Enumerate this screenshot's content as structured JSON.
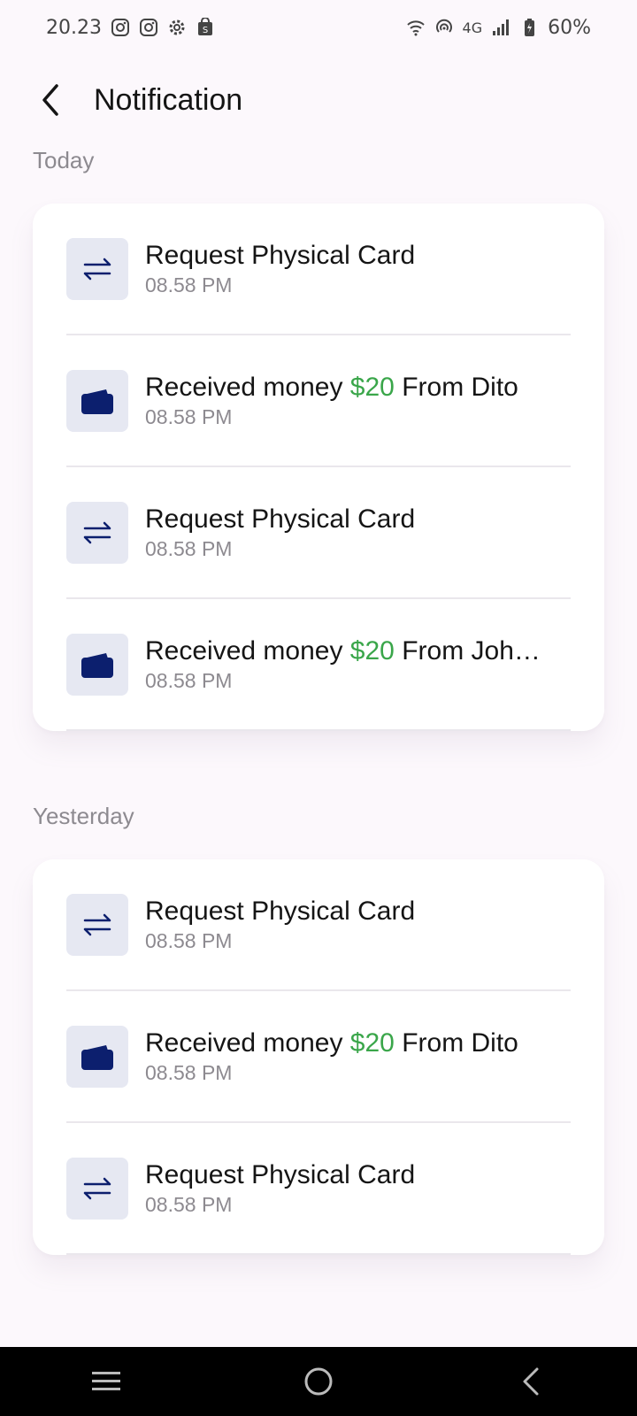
{
  "status_bar": {
    "time": "20.23",
    "network": "4G",
    "battery": "60%",
    "left_icons": [
      "instagram-icon",
      "instagram-icon",
      "settings-gear-icon",
      "shop-bag-icon"
    ],
    "right_icons": [
      "wifi-icon",
      "hotspot-icon",
      "signal-icon",
      "battery-icon"
    ]
  },
  "header": {
    "back_icon": "chevron-left-icon",
    "title": "Notification"
  },
  "sections": [
    {
      "label": "Today",
      "items": [
        {
          "type": "transfer",
          "icon": "transfer-arrows-icon",
          "title": "Request Physical Card",
          "time": "08.58 PM"
        },
        {
          "type": "money",
          "icon": "wallet-icon",
          "prefix": "Received money ",
          "amount": "$20",
          "suffix": " From Dito",
          "time": "08.58 PM"
        },
        {
          "type": "transfer",
          "icon": "transfer-arrows-icon",
          "title": "Request Physical Card",
          "time": "08.58 PM"
        },
        {
          "type": "money",
          "icon": "wallet-icon",
          "prefix": "Received money ",
          "amount": "$20",
          "suffix": " From Joh…",
          "time": "08.58 PM"
        }
      ]
    },
    {
      "label": "Yesterday",
      "items": [
        {
          "type": "transfer",
          "icon": "transfer-arrows-icon",
          "title": "Request Physical Card",
          "time": "08.58 PM"
        },
        {
          "type": "money",
          "icon": "wallet-icon",
          "prefix": "Received money ",
          "amount": "$20",
          "suffix": " From Dito",
          "time": "08.58 PM"
        },
        {
          "type": "transfer",
          "icon": "transfer-arrows-icon",
          "title": "Request Physical Card",
          "time": "08.58 PM"
        }
      ]
    }
  ],
  "nav_bar": {
    "buttons": [
      "recents-icon",
      "home-icon",
      "back-icon"
    ]
  },
  "colors": {
    "background": "#fcf8fc",
    "card": "#ffffff",
    "icon_bg": "#e6e8f2",
    "icon_fg": "#0c1f6e",
    "amount": "#3aa64a",
    "muted_text": "#8d8a90"
  }
}
